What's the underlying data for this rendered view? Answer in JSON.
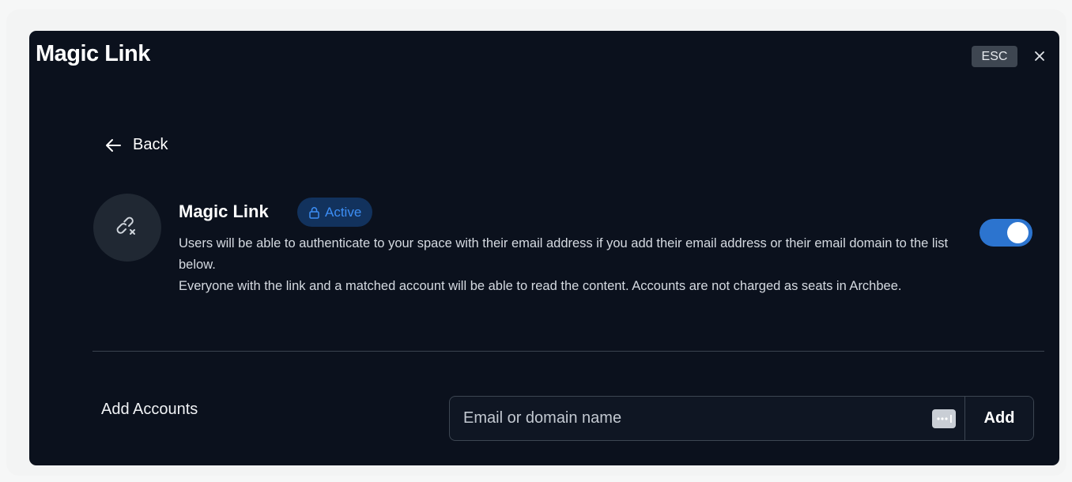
{
  "modal": {
    "title": "Magic Link",
    "esc_label": "ESC"
  },
  "back": {
    "label": "Back"
  },
  "card": {
    "title": "Magic Link",
    "status": "Active",
    "description_1": "Users will be able to authenticate to your space with their email address if you add their email address or their email domain to the list below.",
    "description_2": "Everyone with the link and a matched account will be able to read the content. Accounts are not charged as seats in Archbee.",
    "enabled": true
  },
  "add_accounts": {
    "label": "Add Accounts",
    "input_placeholder": "Email or domain name",
    "input_value": "",
    "button_label": "Add"
  },
  "colors": {
    "modal_background": "#0b111d",
    "accent": "#2c74cf",
    "status_text": "#3c8ef5",
    "status_background": "#12325d"
  },
  "icons": {
    "close": "close-icon",
    "back": "arrow-left-icon",
    "avatar": "link-icon",
    "status": "lock-icon",
    "input": "password-manager-icon"
  }
}
